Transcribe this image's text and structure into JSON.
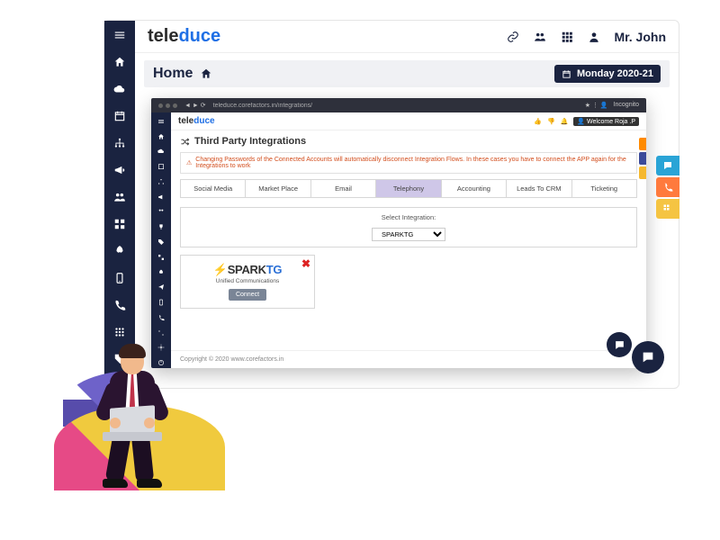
{
  "brand": {
    "prefix": "tele",
    "accent": "duce"
  },
  "header": {
    "user_name": "Mr. John"
  },
  "breadcrumb": {
    "home_label": "Home"
  },
  "date_badge": {
    "label": "Monday 2020-21"
  },
  "outer_sidebar_icons": [
    "menu",
    "home",
    "cloud",
    "calendar",
    "sitemap",
    "bullhorn",
    "users",
    "grid",
    "rocket",
    "mobile",
    "phone",
    "apps",
    "tag"
  ],
  "nested": {
    "url": "teleduce.corefactors.in/integrations/",
    "incognito": "Incognito",
    "brand": {
      "prefix": "tele",
      "accent": "duce"
    },
    "welcome": "Welcome Roja .P",
    "page_title": "Third Party Integrations",
    "warning": "Changing Passwords of the Connected Accounts will automatically disconnect Integration Flows. In these cases you have to connect the APP again for the Integrations to work",
    "tabs": [
      "Social Media",
      "Market Place",
      "Email",
      "Telephony",
      "Accounting",
      "Leads To CRM",
      "Ticketing"
    ],
    "active_tab": "Telephony",
    "select_label": "Select Integration:",
    "select_value": "SPARKTG",
    "card": {
      "logo_prefix": "SPARK",
      "logo_suffix": "TG",
      "tagline": "Unified Communications",
      "connect_label": "Connect"
    },
    "footer": "Copyright © 2020 www.corefactors.in"
  },
  "colors": {
    "navy": "#1a2340",
    "blue": "#1f6fe5",
    "tab_active": "#cfc7e8",
    "warn": "#d24d1c"
  }
}
